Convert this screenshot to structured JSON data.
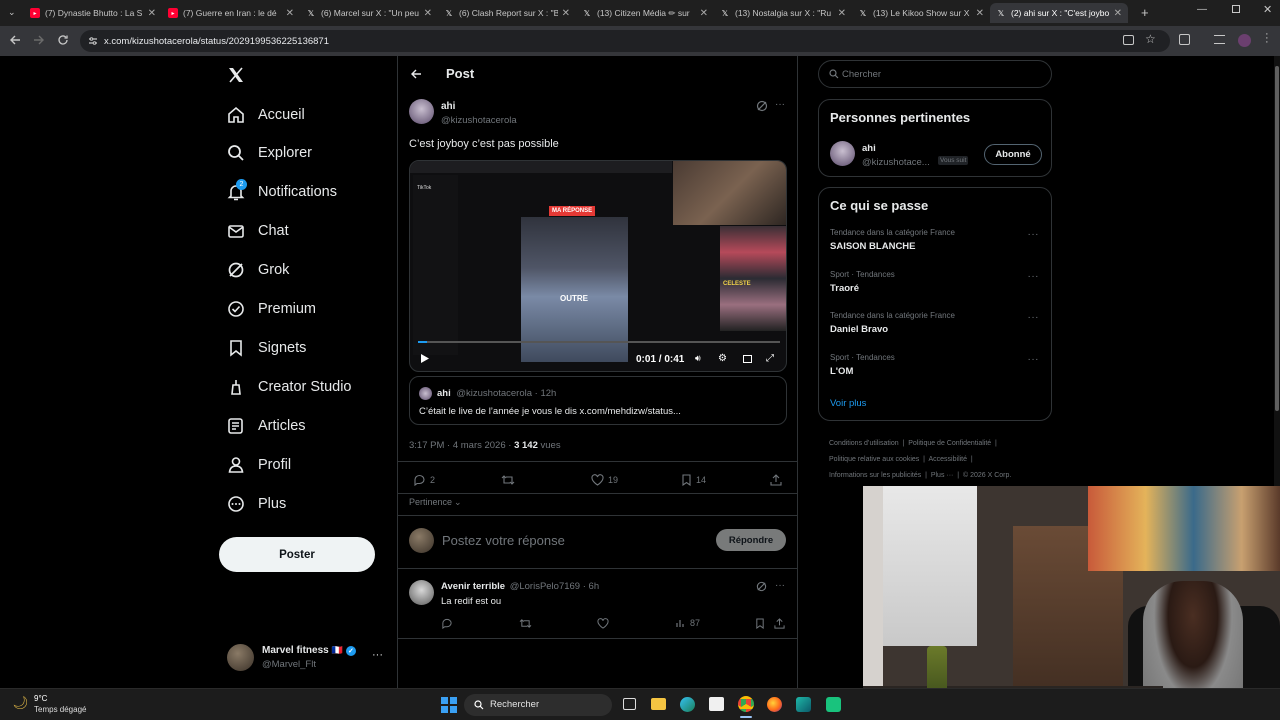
{
  "browser": {
    "tabs": [
      {
        "title": "(7) Dynastie Bhutto : La S",
        "favicon": "youtube-icon"
      },
      {
        "title": "(7) Guerre en Iran : le dé",
        "favicon": "youtube-icon"
      },
      {
        "title": "(6) Marcel sur X : \"Un peu",
        "favicon": "x-logo-icon"
      },
      {
        "title": "(6) Clash Report sur X : \"B",
        "favicon": "x-logo-icon"
      },
      {
        "title": "(13) Citizen Média ✏ sur",
        "favicon": "x-logo-icon"
      },
      {
        "title": "(13) Nostalgia sur X : \"Ru",
        "favicon": "x-logo-icon"
      },
      {
        "title": "(13) Le Kikoo Show sur X",
        "favicon": "x-logo-icon"
      },
      {
        "title": "(2) ahi sur X : \"C'est joybo",
        "favicon": "x-logo-icon",
        "active": true
      }
    ],
    "url": "x.com/kizushotacerola/status/2029199536225136871"
  },
  "nav": {
    "items": [
      {
        "label": "Accueil",
        "icon": "home-icon"
      },
      {
        "label": "Explorer",
        "icon": "search-icon"
      },
      {
        "label": "Notifications",
        "icon": "bell-icon",
        "badge": "2"
      },
      {
        "label": "Chat",
        "icon": "mail-icon"
      },
      {
        "label": "Grok",
        "icon": "grok-icon"
      },
      {
        "label": "Premium",
        "icon": "premium-icon"
      },
      {
        "label": "Signets",
        "icon": "bookmark-icon"
      },
      {
        "label": "Creator Studio",
        "icon": "creator-studio-icon"
      },
      {
        "label": "Articles",
        "icon": "articles-icon"
      },
      {
        "label": "Profil",
        "icon": "person-icon"
      },
      {
        "label": "Plus",
        "icon": "more-circle-icon"
      }
    ],
    "post_button": "Poster",
    "account": {
      "name": "Marvel fitness",
      "flag": "🇫🇷",
      "handle": "@Marvel_Flt"
    }
  },
  "post": {
    "header_title": "Post",
    "author": {
      "name": "ahi",
      "handle": "@kizushotacerola"
    },
    "text": "C’est joyboy c’est pas possible",
    "video": {
      "time": "0:01 / 0:41",
      "tiktok_label": "TikTok",
      "badge": "MA RÉPONSE",
      "overlay_word": "OUTRE",
      "thumb_caption": "CELESTE"
    },
    "quote": {
      "name": "ahi",
      "handle": "@kizushotacerola",
      "sep": "·",
      "time": "12h",
      "text": "C’était le live de l’année je vous le dis x.com/mehdizw/status..."
    },
    "meta": {
      "time": "3:17 PM · 4 mars 2026 · ",
      "views_count": "3 142",
      "views_label": " vues"
    },
    "stats": {
      "replies": "2",
      "likes": "19",
      "bookmarks": "14"
    },
    "sort_label": "Pertinence",
    "reply_placeholder": "Postez votre réponse",
    "reply_button": "Répondre"
  },
  "reply": {
    "name": "Avenir terrible",
    "handle": "@LorisPelo7169",
    "sep": "·",
    "time": "6h",
    "text": "La redif est ou",
    "views": "87"
  },
  "sidebar": {
    "search_placeholder": "Chercher",
    "relevant_title": "Personnes pertinentes",
    "relevant_person": {
      "name": "ahi",
      "handle": "@kizushotace...",
      "follows_you": "Vous suit",
      "button": "Abonné"
    },
    "trends_title": "Ce qui se passe",
    "trends": [
      {
        "context": "Tendance dans la catégorie France",
        "name": "SAISON BLANCHE"
      },
      {
        "context": "Sport · Tendances",
        "name": "Traoré"
      },
      {
        "context": "Tendance dans la catégorie France",
        "name": "Daniel Bravo"
      },
      {
        "context": "Sport · Tendances",
        "name": "L'OM"
      }
    ],
    "show_more": "Voir plus",
    "footer": {
      "line1": [
        "Conditions d’utilisation",
        "Politique de Confidentialité"
      ],
      "line2": [
        "Politique relative aux cookies",
        "Accessibilité"
      ],
      "line3": [
        "Informations sur les publicités",
        "Plus ···",
        "© 2026 X Corp."
      ]
    }
  },
  "taskbar": {
    "temperature": "9°C",
    "weather": "Temps dégagé",
    "search": "Rechercher"
  },
  "colors": {
    "accent": "#1d9bf0",
    "badge_red": "#ff3b5c",
    "background": "#000000",
    "border": "#2f3336"
  }
}
